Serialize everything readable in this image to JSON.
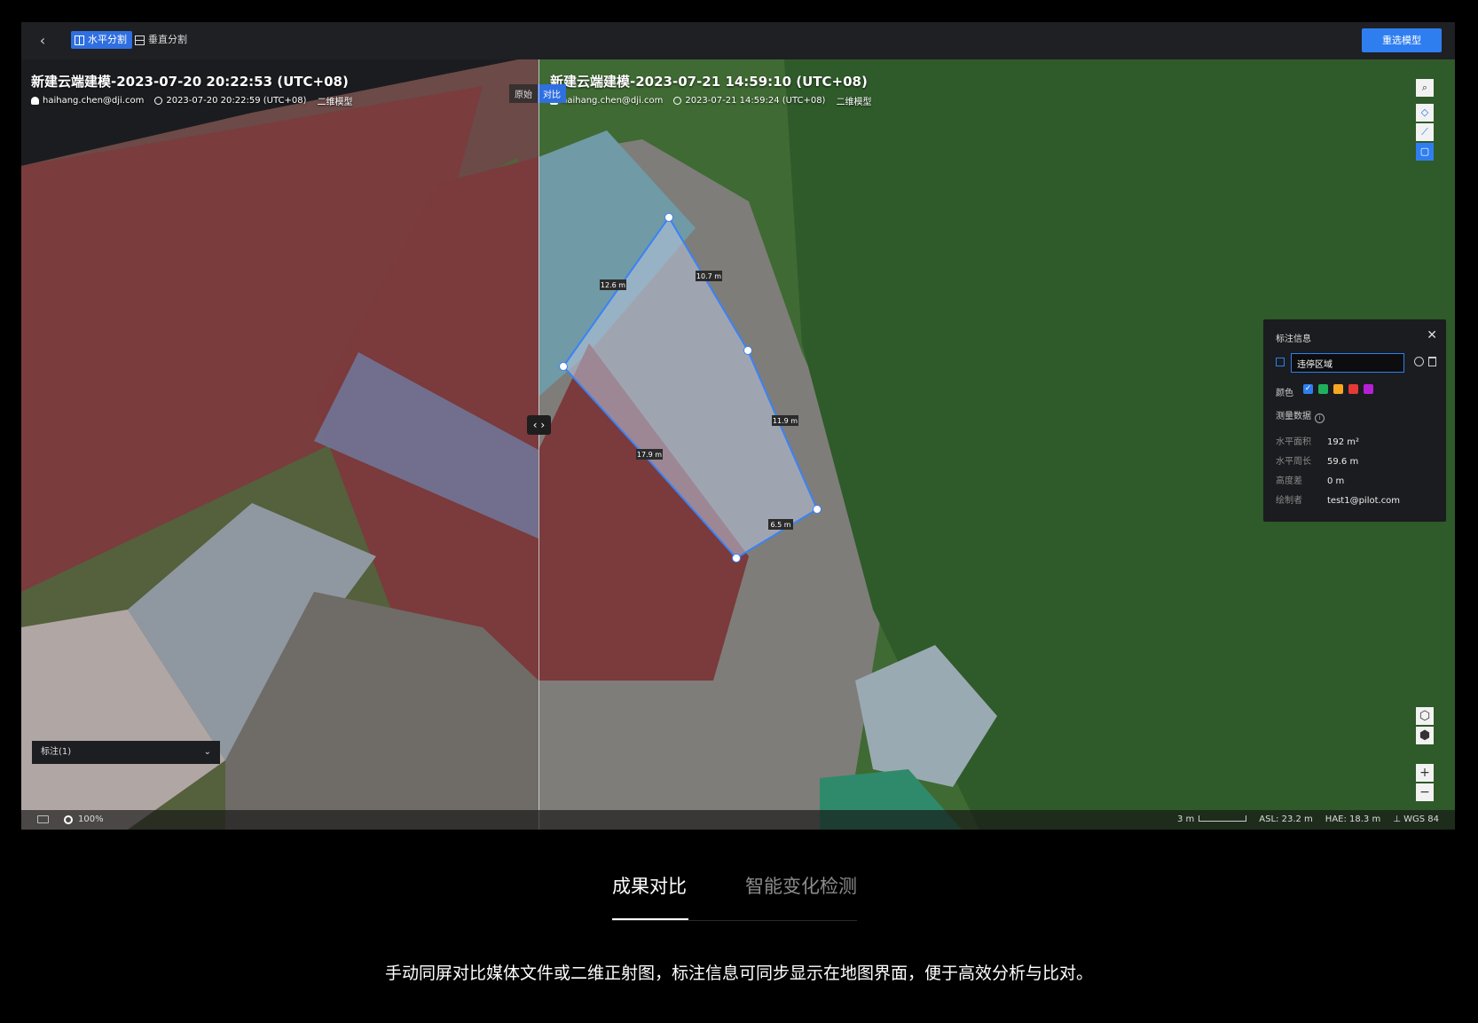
{
  "toolbar": {
    "split_horizontal": "水平分割",
    "split_vertical": "垂直分割",
    "reselect_model": "重选模型"
  },
  "left_model": {
    "title": "新建云端建模-2023-07-20 20:22:53 (UTC+08)",
    "user": "haihang.chen@dji.com",
    "time": "2023-07-20 20:22:59 (UTC+08)",
    "type": "二维模型"
  },
  "right_model": {
    "title": "新建云端建模-2023-07-21 14:59:10 (UTC+08)",
    "user": "haihang.chen@dji.com",
    "time": "2023-07-21 14:59:24 (UTC+08)",
    "type": "二维模型"
  },
  "compare_tags": {
    "original": "原始",
    "compare": "对比"
  },
  "polygon": {
    "color": "#3b82f6",
    "edge_labels": [
      "10.7 m",
      "11.9 m",
      "6.5 m",
      "17.9 m",
      "12.6 m"
    ]
  },
  "annotation_panel": {
    "title": "标注信息",
    "name_value": "违停区域",
    "color_label": "颜色",
    "colors": [
      "#2f7ef0",
      "#1fb05c",
      "#f5a623",
      "#e53935",
      "#b520d6"
    ],
    "selected_color": 0,
    "measure_label": "测量数据",
    "measurements": [
      {
        "label": "水平面积",
        "value": "192 m²"
      },
      {
        "label": "水平周长",
        "value": "59.6 m"
      },
      {
        "label": "高度差",
        "value": "0 m"
      },
      {
        "label": "绘制者",
        "value": "test1@pilot.com"
      }
    ]
  },
  "layer_select": {
    "label": "标注(1)"
  },
  "statusbar": {
    "zoom": "100%",
    "scale": "3 m",
    "asl": "ASL: 23.2 m",
    "hae": "HAE: 18.3 m",
    "crs": "WGS 84"
  },
  "tabs": [
    {
      "label": "成果对比",
      "active": true
    },
    {
      "label": "智能变化检测",
      "active": false
    }
  ],
  "caption": "手动同屏对比媒体文件或二维正射图，标注信息可同步显示在地图界面，便于高效分析与比对。"
}
